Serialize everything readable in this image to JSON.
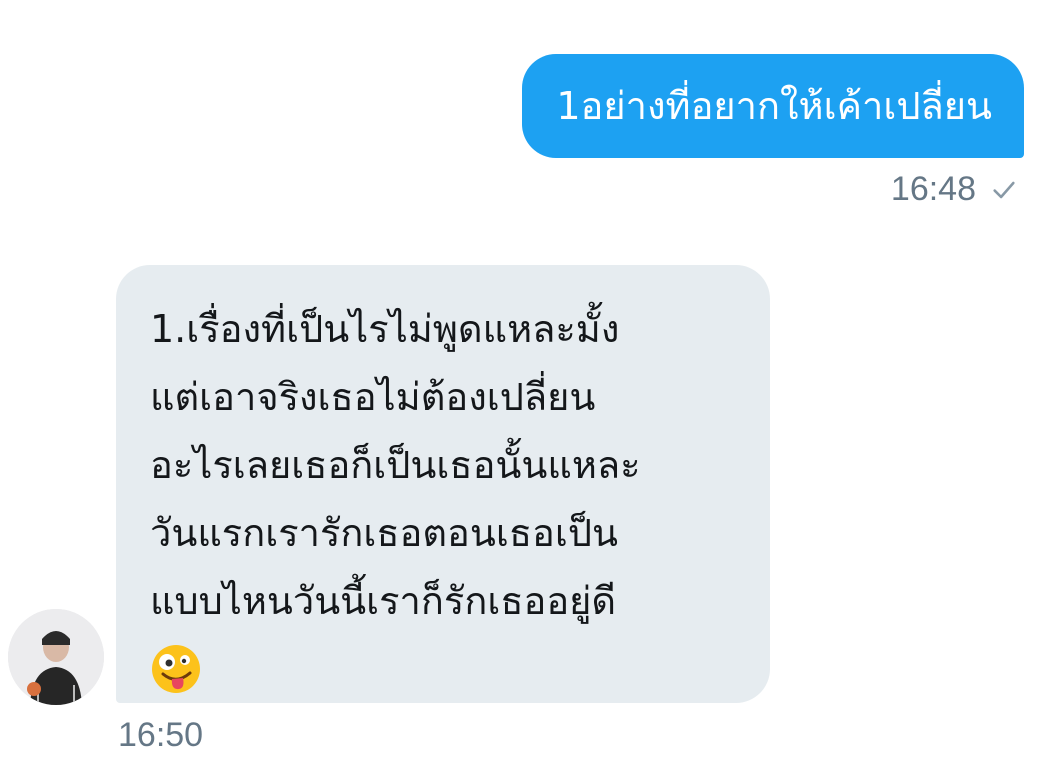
{
  "outgoing": {
    "text": "1อย่างที่อยากให้เค้าเปลี่ยน",
    "time": "16:48",
    "status_icon": "check-icon"
  },
  "incoming": {
    "lines": [
      "1.เรื่องที่เป็นไรไม่พูดแหละมั้ง",
      "แต่เอาจริงเธอไม่ต้องเปลี่ยน",
      "อะไรเลยเธอก็เป็นเธอนั้นแหละ",
      "วันแรกเรารักเธอตอนเธอเป็น",
      "แบบไหนวันนี้เราก็รักเธออยู่ดี"
    ],
    "emoji": "zany-face-emoji",
    "time": "16:50",
    "avatar": "user-avatar"
  },
  "colors": {
    "outgoing_bubble": "#1da1f2",
    "incoming_bubble": "#e6ecf0",
    "meta_text": "#657786"
  }
}
